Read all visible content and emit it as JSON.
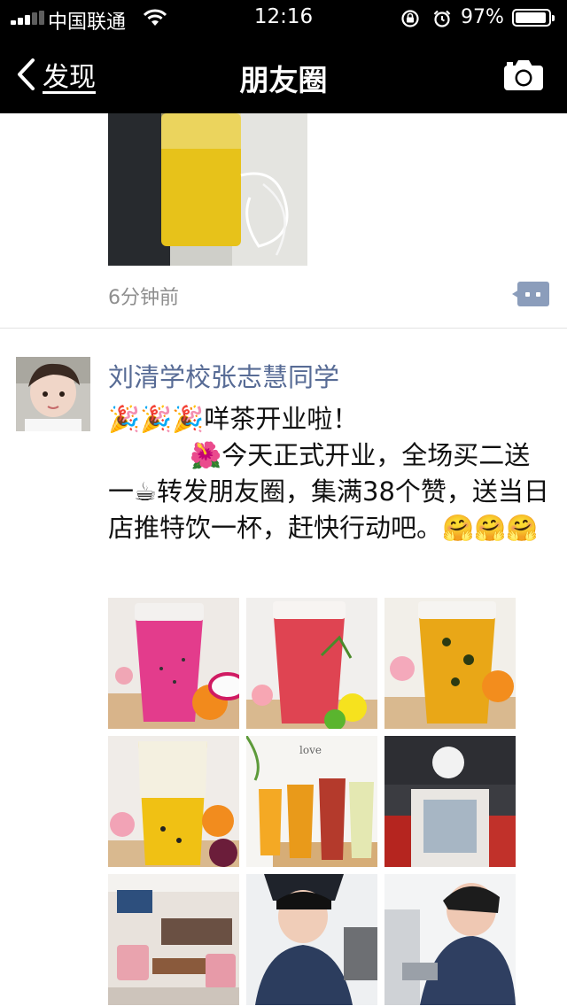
{
  "status": {
    "carrier": "中国联通",
    "time": "12:16",
    "battery": "97%"
  },
  "nav": {
    "back_label": "发现",
    "title": "朋友圈"
  },
  "prev_post": {
    "timestamp": "6分钟前"
  },
  "post": {
    "author": "刘清学校张志慧同学",
    "text": "🎉🎉🎉咩茶开业啦！\n          🌺今天正式开业，全场买二送一☕转发朋友圈，集满38个赞，送当日店推特饮一杯，赶快行动吧。🤗🤗🤗"
  },
  "colors": {
    "link": "#576b95",
    "nav_bg": "#000000",
    "comment_icon": "#8b9dbb"
  },
  "icons": {
    "back": "chevron-left-icon",
    "camera": "camera-icon",
    "comment": "comment-icon",
    "wifi": "wifi-icon",
    "lock": "rotation-lock-icon",
    "alarm": "alarm-icon"
  },
  "photo_subjects": [
    "pink dragon fruit milk tea",
    "red fruit tea with lemon",
    "passion fruit tea with orange",
    "mango passion fruit tea",
    "four fruit teas in tray",
    "shop storefront",
    "shop interior seating",
    "staff preparing drinks",
    "staff at counter"
  ]
}
